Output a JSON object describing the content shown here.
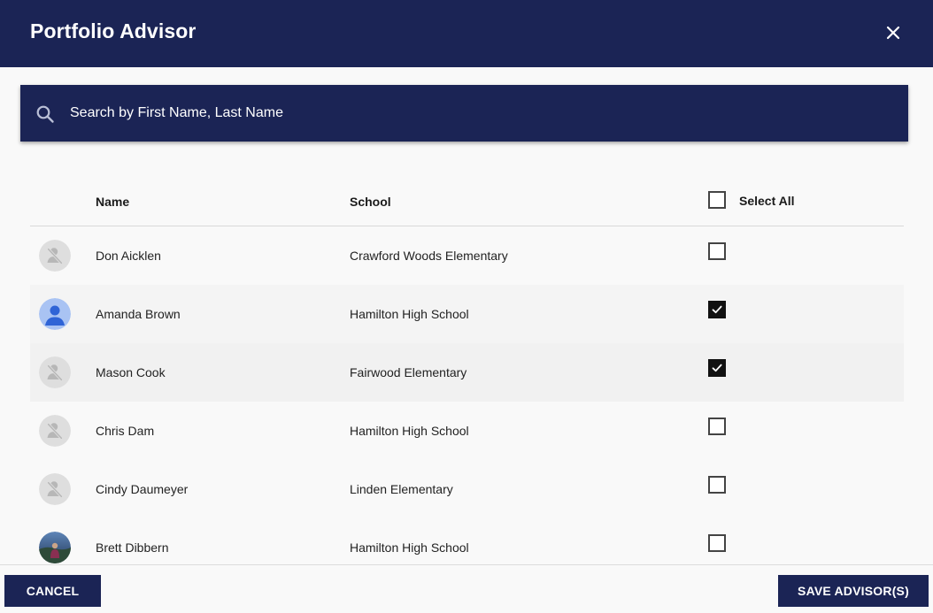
{
  "header": {
    "title": "Portfolio Advisor",
    "close_icon": "close-icon"
  },
  "search": {
    "placeholder": "Search by First Name, Last Name",
    "value": "",
    "icon": "search-icon"
  },
  "table": {
    "columns": {
      "name": "Name",
      "school": "School",
      "select_all": "Select All"
    },
    "select_all_checked": false,
    "rows": [
      {
        "name": "Don Aicklen",
        "school": "Crawford Woods Elementary",
        "checked": false,
        "avatar": "no-photo-icon"
      },
      {
        "name": "Amanda Brown",
        "school": "Hamilton High School",
        "checked": true,
        "avatar": "person-icon"
      },
      {
        "name": "Mason Cook",
        "school": "Fairwood Elementary",
        "checked": true,
        "avatar": "no-photo-icon"
      },
      {
        "name": "Chris Dam",
        "school": "Hamilton High School",
        "checked": false,
        "avatar": "no-photo-icon"
      },
      {
        "name": "Cindy Daumeyer",
        "school": "Linden Elementary",
        "checked": false,
        "avatar": "no-photo-icon"
      },
      {
        "name": "Brett Dibbern",
        "school": "Hamilton High School",
        "checked": false,
        "avatar": "photo"
      }
    ]
  },
  "footer": {
    "cancel_label": "CANCEL",
    "save_label": "SAVE ADVISOR(S)"
  },
  "colors": {
    "primary": "#1b2455",
    "background": "#f9f9f9",
    "row_alt": "#f1f1f1"
  }
}
